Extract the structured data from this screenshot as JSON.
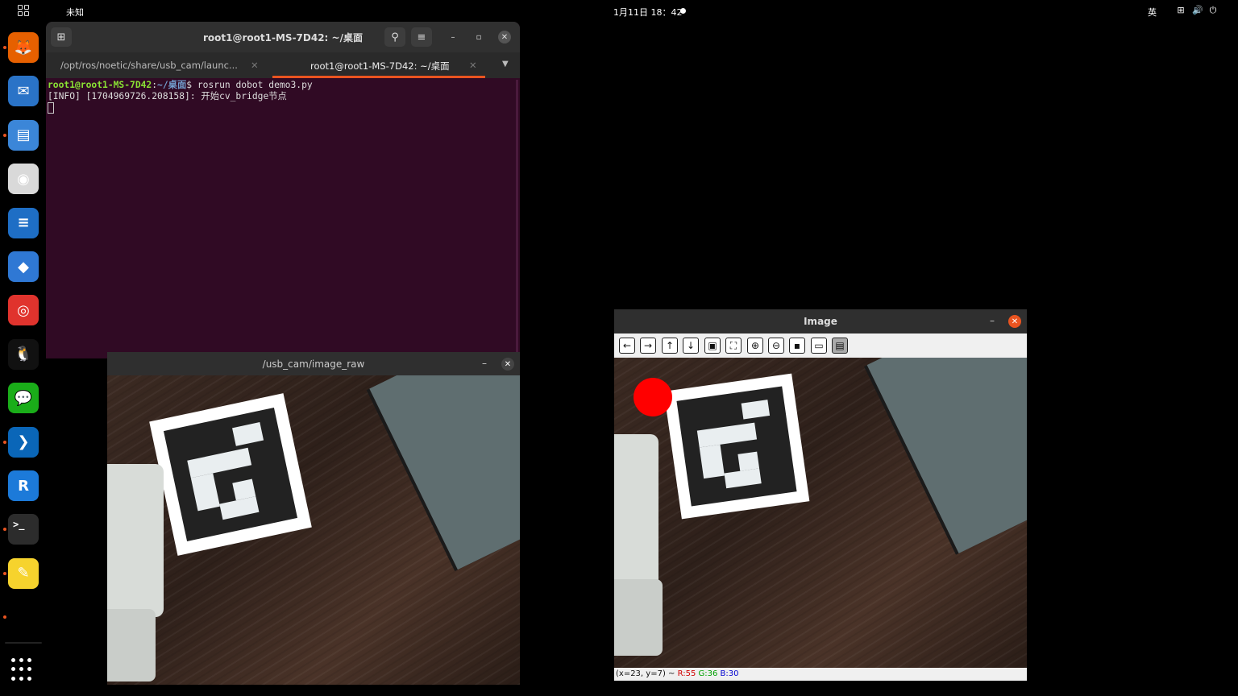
{
  "topbar": {
    "app_name": "未知",
    "clock": "1月11日 18：42",
    "ime": "英",
    "tray_icons": [
      "network-icon",
      "volume-icon",
      "power-icon"
    ]
  },
  "dock": {
    "apps": [
      {
        "name": "firefox-icon",
        "color": "#e66000",
        "glyph": "🦊",
        "running": true
      },
      {
        "name": "thunderbird-icon",
        "color": "#2a73c7",
        "glyph": "✉",
        "running": false
      },
      {
        "name": "files-icon",
        "color": "#3b86d8",
        "glyph": "▤",
        "running": true
      },
      {
        "name": "rhythmbox-icon",
        "color": "#d9d9d9",
        "glyph": "◉",
        "running": false
      },
      {
        "name": "writer-icon",
        "color": "#1e6ec5",
        "glyph": "≡",
        "running": false
      },
      {
        "name": "software-icon",
        "color": "#2f78d4",
        "glyph": "◆",
        "running": false
      },
      {
        "name": "help-icon",
        "color": "#e0332d",
        "glyph": "◎",
        "running": false
      },
      {
        "name": "qq-icon",
        "color": "#111111",
        "glyph": "🐧",
        "running": false
      },
      {
        "name": "wechat-icon",
        "color": "#1aad19",
        "glyph": "💬",
        "running": false
      },
      {
        "name": "vscode-icon",
        "color": "#0a66b8",
        "glyph": "❯",
        "running": true
      },
      {
        "name": "realvnc-icon",
        "color": "#1c7ad9",
        "glyph": "R",
        "running": false
      },
      {
        "name": "terminal-icon",
        "color": "#2c2c2c",
        "glyph": ">_",
        "running": true
      },
      {
        "name": "text-editor-icon",
        "color": "#f6d32d",
        "glyph": "✎",
        "running": true
      }
    ]
  },
  "terminal": {
    "title": "root1@root1-MS-7D42: ~/桌面",
    "tabs": [
      {
        "label": "/opt/ros/noetic/share/usb_cam/launc...",
        "active": false
      },
      {
        "label": "root1@root1-MS-7D42: ~/桌面",
        "active": true
      }
    ],
    "prompt_user": "root1@root1-MS-7D42",
    "prompt_sep": ":",
    "prompt_path": "~/桌面",
    "prompt_end": "$ ",
    "command": "rosrun dobot demo3.py",
    "output": "[INFO] [1704969726.208158]: 开始cv_bridge节点"
  },
  "raw_window": {
    "title": "/usb_cam/image_raw"
  },
  "image_window": {
    "title": "Image",
    "tools": [
      "arrow-left-icon",
      "arrow-right-icon",
      "arrow-up-icon",
      "arrow-down-icon",
      "fit-image-icon",
      "zoom-image-icon",
      "zoom-in-icon",
      "zoom-out-icon",
      "save-icon",
      "copy-icon",
      "properties-icon"
    ],
    "status_prefix": "(x=23, y=7) ~ ",
    "status_r": "R:55",
    "status_g": "G:36",
    "status_b": "B:30"
  },
  "colors": {
    "accent": "#e95420",
    "terminal_bg": "#300a24",
    "marker_dot": "#ff0000"
  }
}
